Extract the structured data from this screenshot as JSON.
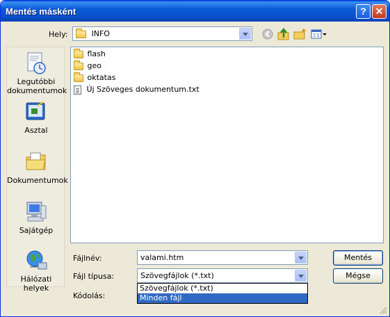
{
  "window": {
    "title": "Mentés másként"
  },
  "titlebar": {
    "help_label": "?",
    "close_label": "✕"
  },
  "location": {
    "label": "Hely:",
    "value": "INFO",
    "icons": [
      "back-icon",
      "up-folder-icon",
      "new-folder-icon",
      "view-menu-icon"
    ]
  },
  "places": [
    {
      "label": "Legutóbbi dokumentumok",
      "icon": "recent-documents-icon"
    },
    {
      "label": "Asztal",
      "icon": "desktop-icon"
    },
    {
      "label": "Dokumentumok",
      "icon": "my-documents-icon"
    },
    {
      "label": "Sajátgép",
      "icon": "my-computer-icon"
    },
    {
      "label": "Hálózati helyek",
      "icon": "network-places-icon"
    }
  ],
  "files": [
    {
      "name": "flash",
      "type": "folder"
    },
    {
      "name": "geo",
      "type": "folder"
    },
    {
      "name": "oktatas",
      "type": "folder"
    },
    {
      "name": "Új Szöveges dokumentum.txt",
      "type": "text-file"
    }
  ],
  "form": {
    "filename_label": "Fájlnév:",
    "filename_value": "valami.htm",
    "filetype_label": "Fájl típusa:",
    "filetype_value": "Szövegfájlok (*.txt)",
    "encoding_label": "Kódolás:"
  },
  "filetype_options": [
    {
      "label": "Szövegfájlok (*.txt)",
      "selected": false
    },
    {
      "label": "Minden fájl",
      "selected": true
    }
  ],
  "buttons": {
    "save": "Mentés",
    "cancel": "Mégse"
  },
  "colors": {
    "title_bar": "#0a50cc",
    "selection": "#316ac5",
    "dialog_bg": "#ece9d8"
  }
}
